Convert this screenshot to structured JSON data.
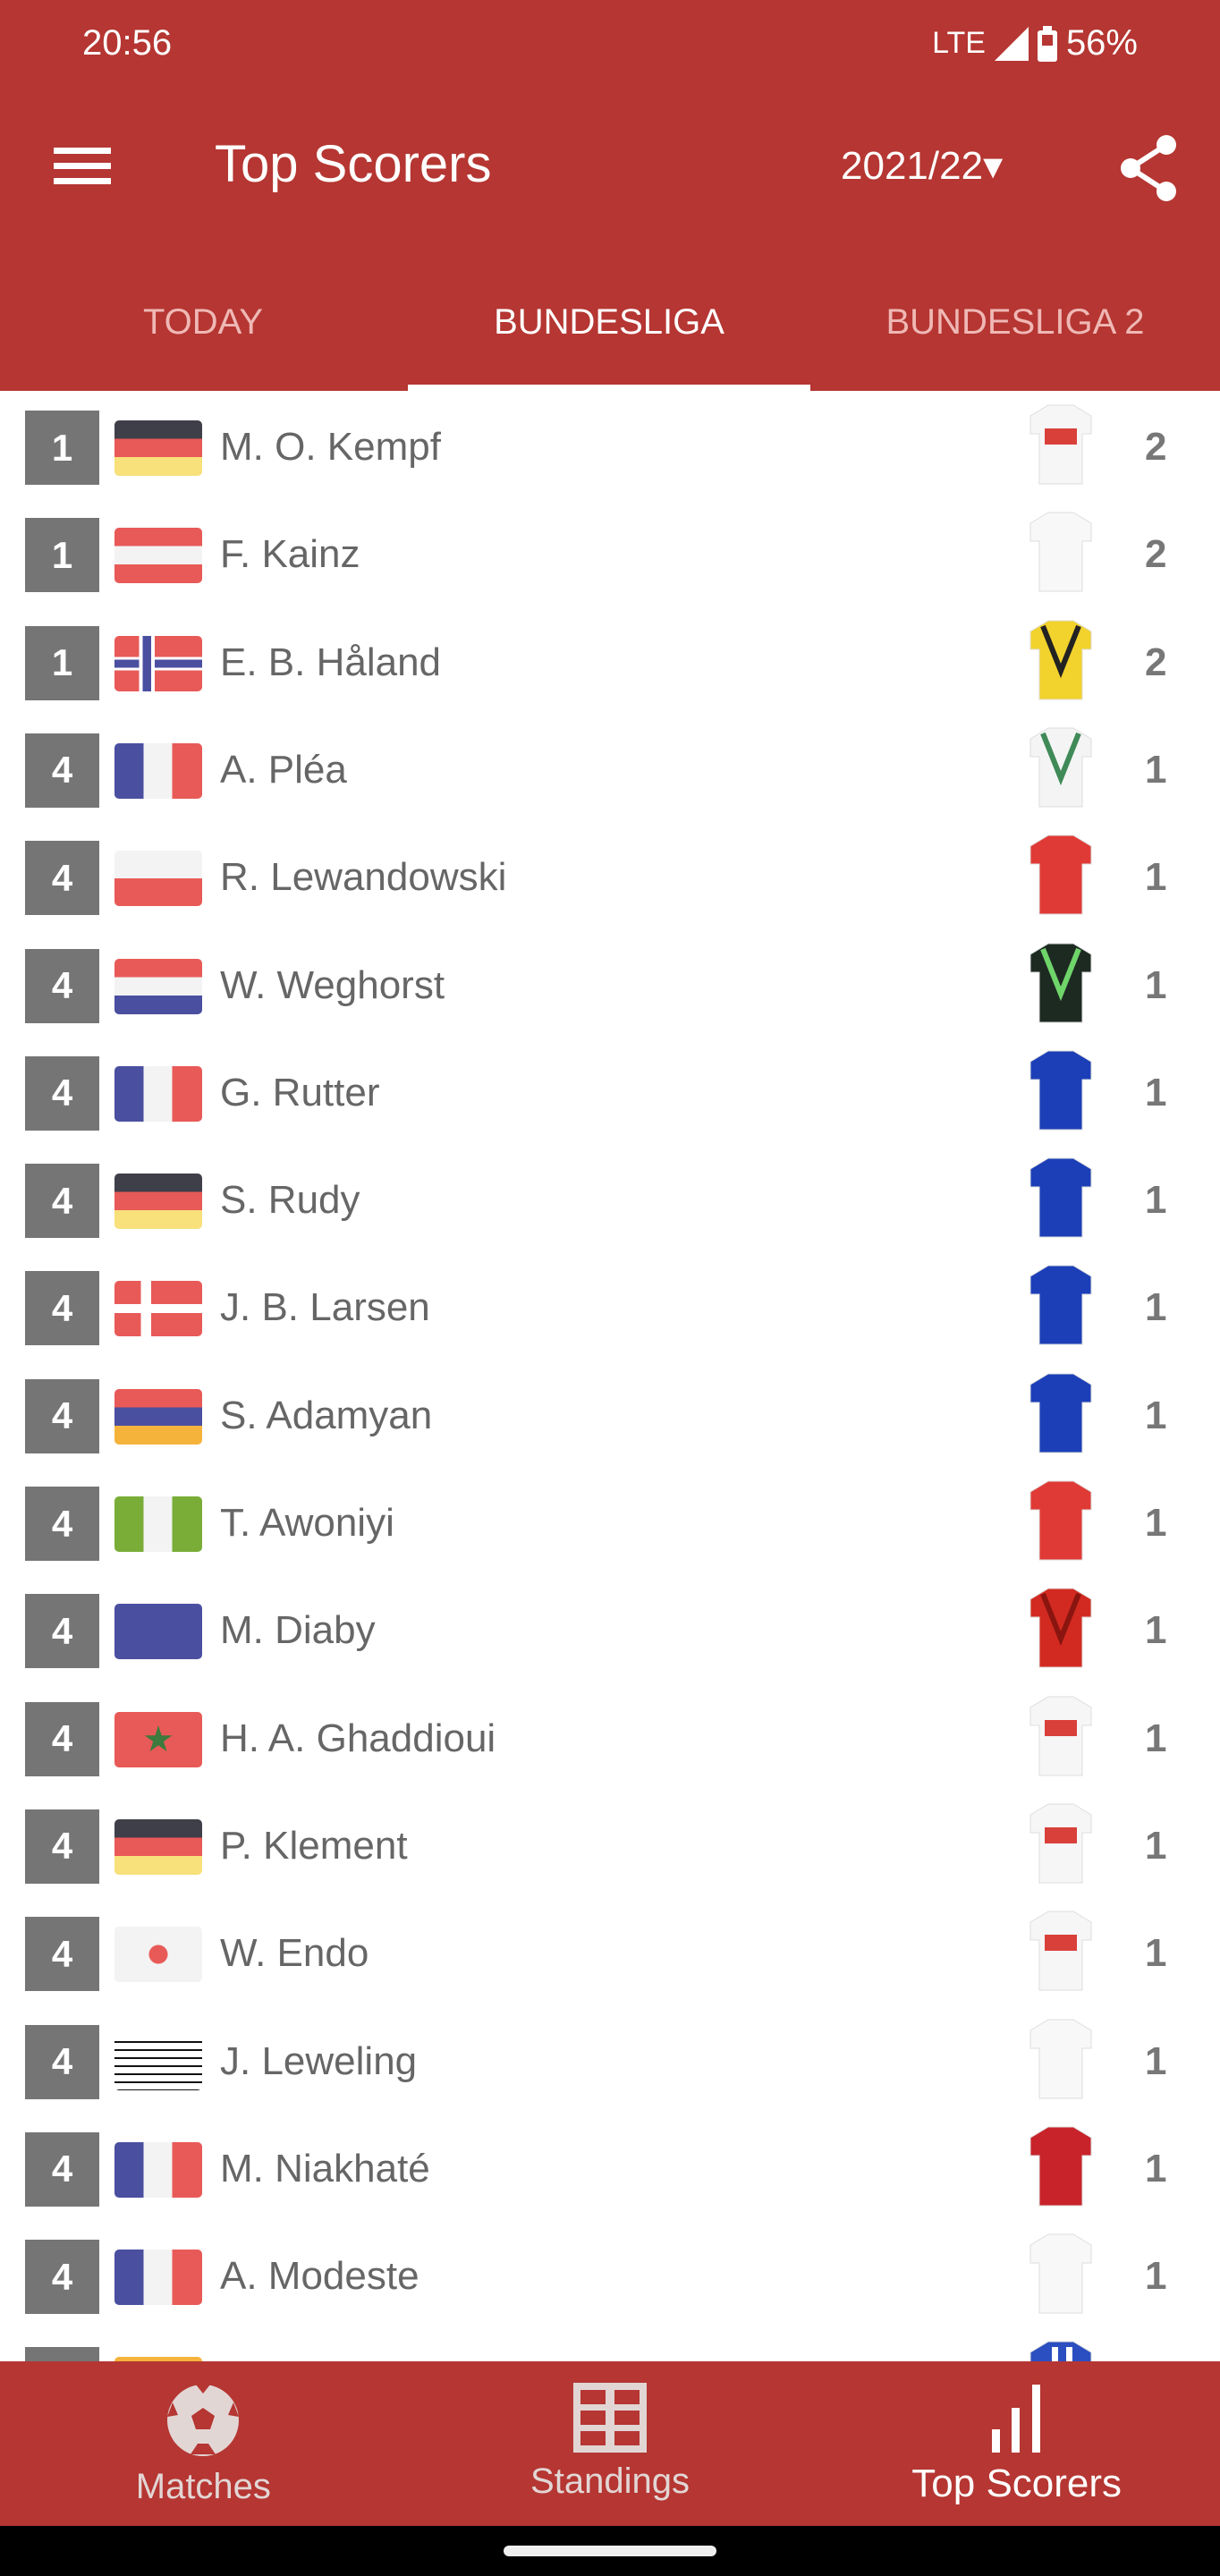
{
  "status_bar": {
    "time": "20:56",
    "network": "LTE",
    "battery": "56%"
  },
  "app_bar": {
    "title": "Top Scorers",
    "season": "2021/22",
    "season_arrow": "▾",
    "menu_icon": "hamburger-icon",
    "share_icon": "share-icon"
  },
  "tabs": [
    {
      "label": "TODAY"
    },
    {
      "label": "BUNDESLIGA",
      "active": true
    },
    {
      "label": "BUNDESLIGA 2"
    }
  ],
  "colors": {
    "primary": "#b53632",
    "rank_badge": "#757575"
  },
  "scorers": [
    {
      "rank": "1",
      "flag": "germany",
      "name": "M. O. Kempf",
      "shirt": "white-red-band",
      "goals": "2"
    },
    {
      "rank": "1",
      "flag": "austria",
      "name": "F. Kainz",
      "shirt": "white",
      "goals": "2"
    },
    {
      "rank": "1",
      "flag": "norway",
      "name": "E. B. Håland",
      "shirt": "yellow-black",
      "goals": "2"
    },
    {
      "rank": "4",
      "flag": "france",
      "name": "A. Pléa",
      "shirt": "white-green",
      "goals": "1"
    },
    {
      "rank": "4",
      "flag": "poland",
      "name": "R. Lewandowski",
      "shirt": "red",
      "goals": "1"
    },
    {
      "rank": "4",
      "flag": "netherlands",
      "name": "W. Weghorst",
      "shirt": "black-green",
      "goals": "1"
    },
    {
      "rank": "4",
      "flag": "france",
      "name": "G. Rutter",
      "shirt": "blue",
      "goals": "1"
    },
    {
      "rank": "4",
      "flag": "germany",
      "name": "S. Rudy",
      "shirt": "blue",
      "goals": "1"
    },
    {
      "rank": "4",
      "flag": "denmark",
      "name": "J. B. Larsen",
      "shirt": "blue",
      "goals": "1"
    },
    {
      "rank": "4",
      "flag": "armenia",
      "name": "S. Adamyan",
      "shirt": "blue",
      "goals": "1"
    },
    {
      "rank": "4",
      "flag": "nigeria",
      "name": "T. Awoniyi",
      "shirt": "red",
      "goals": "1"
    },
    {
      "rank": "4",
      "flag": "reunion",
      "name": "M. Diaby",
      "shirt": "dark-red",
      "goals": "1"
    },
    {
      "rank": "4",
      "flag": "morocco",
      "name": "H. A. Ghaddioui",
      "shirt": "white-red-band",
      "goals": "1"
    },
    {
      "rank": "4",
      "flag": "germany",
      "name": "P. Klement",
      "shirt": "white-red-band",
      "goals": "1"
    },
    {
      "rank": "4",
      "flag": "japan",
      "name": "W. Endo",
      "shirt": "white-red-band",
      "goals": "1"
    },
    {
      "rank": "4",
      "flag": "striped-placeholder",
      "name": "J. Leweling",
      "shirt": "white",
      "goals": "1"
    },
    {
      "rank": "4",
      "flag": "france",
      "name": "M. Niakhaté",
      "shirt": "crimson",
      "goals": "1"
    },
    {
      "rank": "4",
      "flag": "france",
      "name": "A. Modeste",
      "shirt": "white",
      "goals": "1"
    },
    {
      "rank": "",
      "flag": "spain",
      "name": "",
      "shirt": "blue-white-stripes",
      "goals": ""
    }
  ],
  "bottom_nav": [
    {
      "label": "Matches",
      "icon": "soccer-ball-icon"
    },
    {
      "label": "Standings",
      "icon": "table-grid-icon"
    },
    {
      "label": "Top Scorers",
      "icon": "bar-chart-icon",
      "active": true
    }
  ]
}
